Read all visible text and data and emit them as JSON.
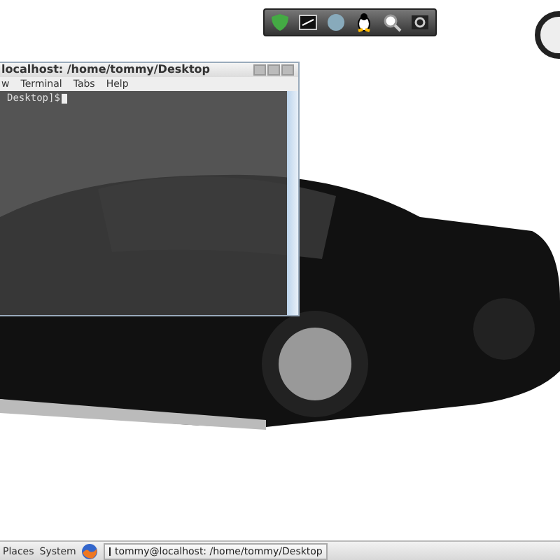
{
  "terminal": {
    "title": "localhost: /home/tommy/Desktop",
    "menu": [
      "w",
      "Terminal",
      "Tabs",
      "Help"
    ],
    "prompt": "Desktop]$"
  },
  "taskbar": {
    "menus": [
      "Places",
      "System"
    ],
    "tasks": [
      {
        "label": "tommy@localhost: /home/tommy/Desktop"
      }
    ]
  }
}
